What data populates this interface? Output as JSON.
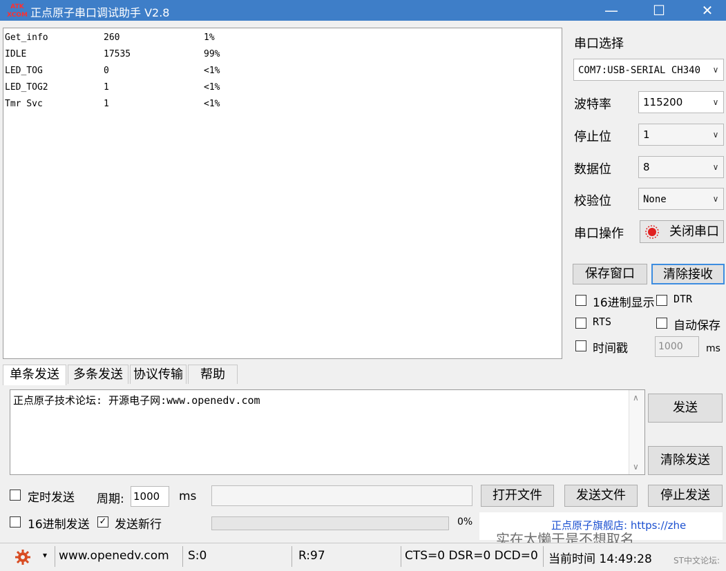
{
  "window": {
    "title": "正点原子串口调试助手 V2.8",
    "logo_top": "ATK",
    "logo_bottom": "XCOM",
    "min_glyph": "—",
    "max_glyph": "☐",
    "close_glyph": "✕"
  },
  "receive": {
    "rows": [
      {
        "name": "Get_info",
        "count": "260",
        "pct": "1%"
      },
      {
        "name": "IDLE",
        "count": "17535",
        "pct": "99%"
      },
      {
        "name": "LED_TOG",
        "count": "0",
        "pct": "<1%"
      },
      {
        "name": "LED_TOG2",
        "count": "1",
        "pct": "<1%"
      },
      {
        "name": "Tmr Svc",
        "count": "1",
        "pct": "<1%"
      }
    ]
  },
  "serial": {
    "select_label": "串口选择",
    "port_value": "COM7:USB-SERIAL CH340",
    "baud_label": "波特率",
    "baud_value": "115200",
    "stopbits_label": "停止位",
    "stopbits_value": "1",
    "databits_label": "数据位",
    "databits_value": "8",
    "parity_label": "校验位",
    "parity_value": "None",
    "op_label": "串口操作",
    "close_port": "关闭串口",
    "save_window": "保存窗口",
    "clear_recv": "清除接收",
    "hex_display": "16进制显示",
    "dtr": "DTR",
    "rts": "RTS",
    "auto_save": "自动保存",
    "timestamp": "时间戳",
    "timestamp_value": "1000",
    "ms": "ms",
    "arrow": "∨"
  },
  "tabs": [
    "单条发送",
    "多条发送",
    "协议传输",
    "帮助"
  ],
  "send": {
    "text": "正点原子技术论坛: 开源电子网:www.openedv.com",
    "send_button": "发送",
    "clear_send": "清除发送",
    "timed_send": "定时发送",
    "period_label": "周期:",
    "period_value": "1000",
    "ms": "ms",
    "open_file": "打开文件",
    "send_file": "发送文件",
    "stop_send": "停止发送",
    "hex_send": "16进制发送",
    "send_newline": "发送新行",
    "progress_pct": "0%",
    "ad_text": "正点原子旗舰店: https://zhe",
    "watermark": "实在太懒于是不想取名",
    "scroll_up": "∧",
    "scroll_down": "∨"
  },
  "status": {
    "website": "www.openedv.com",
    "sent": "S:0",
    "received": "R:97",
    "lines": "CTS=0 DSR=0 DCD=0",
    "time": "当前时间 14:49:28",
    "forum": "ST中文论坛:",
    "dropdown_glyph": "▾"
  },
  "colors": {
    "titlebar": "#3e7ec8",
    "link": "#1a4fd0",
    "close_port_red": "#e02020"
  }
}
